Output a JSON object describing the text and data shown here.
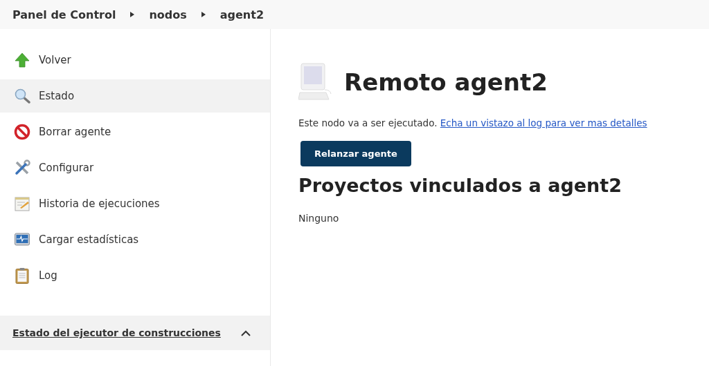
{
  "breadcrumbs": [
    {
      "label": "Panel de Control"
    },
    {
      "label": "nodos"
    },
    {
      "label": "agent2"
    }
  ],
  "sidebar": {
    "items": [
      {
        "label": "Volver",
        "kind": "back",
        "selected": false
      },
      {
        "label": "Estado",
        "kind": "status",
        "selected": true
      },
      {
        "label": "Borrar agente",
        "kind": "delete",
        "selected": false
      },
      {
        "label": "Configurar",
        "kind": "configure",
        "selected": false
      },
      {
        "label": "Historia de ejecuciones",
        "kind": "history",
        "selected": false
      },
      {
        "label": "Cargar estadísticas",
        "kind": "load",
        "selected": false
      },
      {
        "label": "Log",
        "kind": "log",
        "selected": false
      }
    ],
    "panel": {
      "title": "Estado del ejecutor de construcciones",
      "expanded": true
    }
  },
  "main": {
    "title": "Remoto agent2",
    "message": "Este nodo va a ser ejecutado.",
    "link": "Echa un vistazo al log para ver mas detalles",
    "button": "Relanzar agente",
    "projects_title": "Proyectos vinculados a agent2",
    "projects_empty": "Ninguno"
  }
}
